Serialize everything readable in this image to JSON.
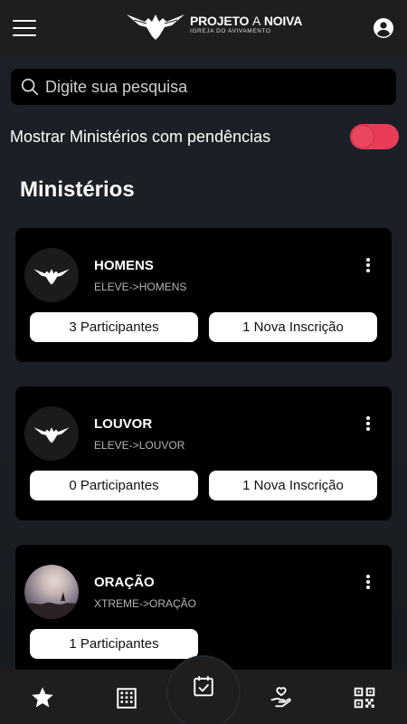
{
  "header": {
    "logo_title_a": "PROJETO",
    "logo_title_b": "A",
    "logo_title_c": "NOIVA",
    "logo_subtitle": "IGREJA DO AVIVAMENTO",
    "menu_icon": "hamburger-icon",
    "account_icon": "account-circle-icon"
  },
  "search": {
    "placeholder": "Digite sua pesquisa",
    "value": "",
    "icon": "search-icon"
  },
  "filter": {
    "label": "Mostrar Ministérios com pendências",
    "toggle_on": true,
    "toggle_color": "#e83c58"
  },
  "section_title": "Ministérios",
  "ministries": [
    {
      "name": "HOMENS",
      "path": "ELEVE->HOMENS",
      "avatar": "eagle-logo",
      "participants": "3 Participantes",
      "inscriptions": "1 Nova Inscrição"
    },
    {
      "name": "LOUVOR",
      "path": "ELEVE->LOUVOR",
      "avatar": "eagle-logo",
      "participants": "0 Participantes",
      "inscriptions": "1 Nova Inscrição"
    },
    {
      "name": "ORAÇÃO",
      "path": "XTREME->ORAÇÃO",
      "avatar": "photo",
      "participants": "1 Participantes",
      "inscriptions": ""
    }
  ],
  "bottom_nav": [
    {
      "icon": "star-icon"
    },
    {
      "icon": "building-icon"
    },
    {
      "icon": "calendar-check-icon"
    },
    {
      "icon": "hand-heart-icon"
    },
    {
      "icon": "qr-code-icon"
    }
  ]
}
